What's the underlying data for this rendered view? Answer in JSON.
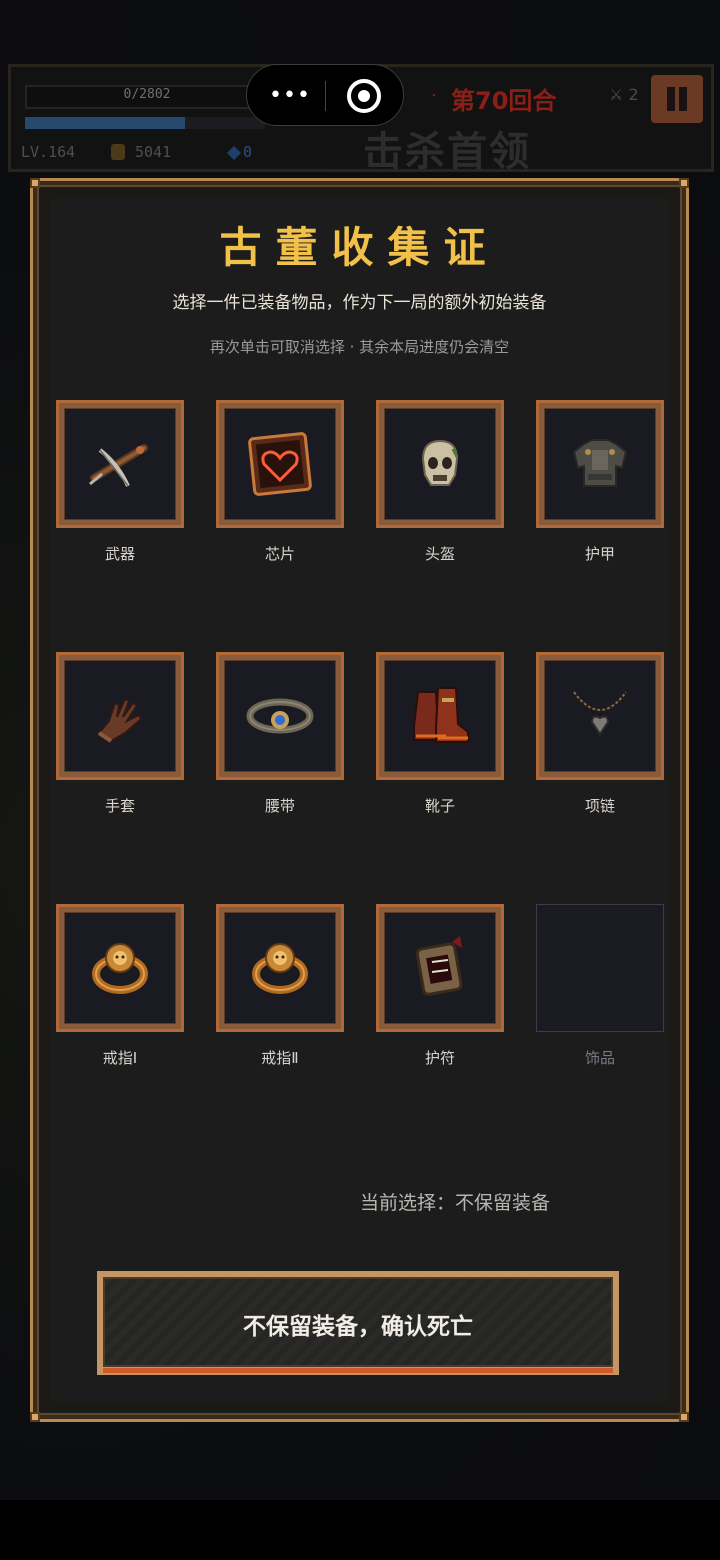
{
  "hud": {
    "hp_text": "0/2802",
    "round_text": "第70回合",
    "kill_count": "2",
    "level": "LV.164",
    "coins": "5041",
    "gems": "0",
    "objective": "击杀首领"
  },
  "capsule": {
    "menu_icon": "more-dots-icon",
    "close_icon": "target-circle-icon"
  },
  "modal": {
    "title": "古董收集证",
    "subtitle": "选择一件已装备物品，作为下一局的额外初始装备",
    "hint": "再次单击可取消选择 · 其余本局进度仍会清空",
    "slots": [
      {
        "label": "武器",
        "icon": "crossbow-icon",
        "filled": true
      },
      {
        "label": "芯片",
        "icon": "heart-chip-icon",
        "filled": true
      },
      {
        "label": "头盔",
        "icon": "skull-helmet-icon",
        "filled": true
      },
      {
        "label": "护甲",
        "icon": "armor-icon",
        "filled": true
      },
      {
        "label": "手套",
        "icon": "glove-icon",
        "filled": true
      },
      {
        "label": "腰带",
        "icon": "belt-icon",
        "filled": true
      },
      {
        "label": "靴子",
        "icon": "boots-icon",
        "filled": true
      },
      {
        "label": "项链",
        "icon": "necklace-icon",
        "filled": true
      },
      {
        "label": "戒指Ⅰ",
        "icon": "ring-icon",
        "filled": true
      },
      {
        "label": "戒指Ⅱ",
        "icon": "ring-icon",
        "filled": true
      },
      {
        "label": "护符",
        "icon": "amulet-icon",
        "filled": true
      },
      {
        "label": "饰品",
        "icon": "",
        "filled": false
      }
    ],
    "current_selection": "当前选择：不保留装备",
    "confirm_label": "不保留装备，确认死亡"
  }
}
